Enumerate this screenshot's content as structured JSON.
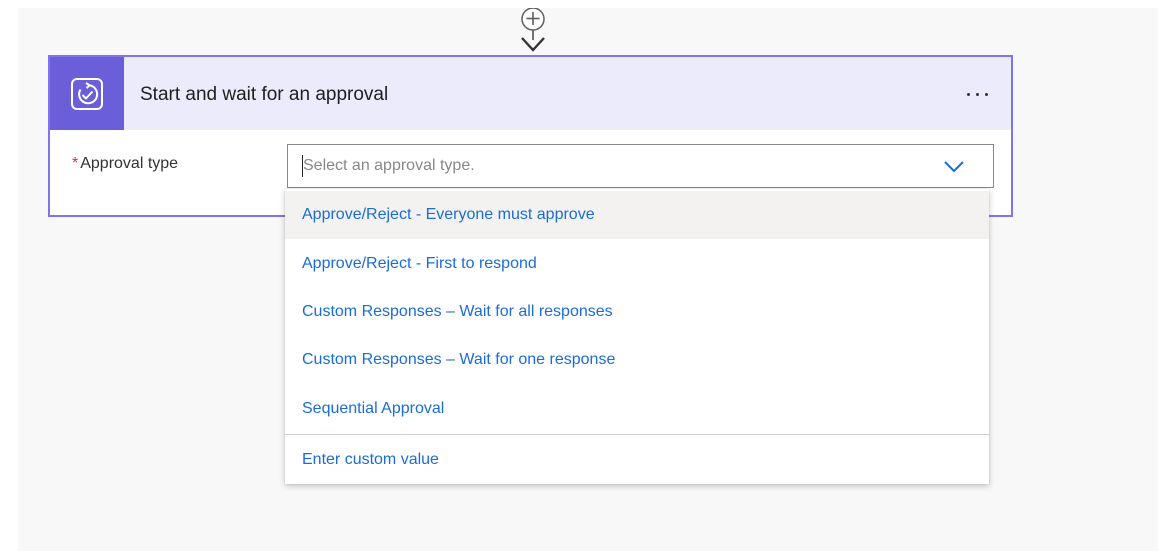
{
  "card": {
    "title": "Start and wait for an approval",
    "icon": "approval-icon",
    "accent_color": "#6a5fd8",
    "header_color": "#ebebfc",
    "more_icon": "ellipsis-icon"
  },
  "field": {
    "required_mark": "*",
    "label": "Approval type",
    "placeholder": "Select an approval type.",
    "value": ""
  },
  "dropdown": {
    "options": [
      "Approve/Reject - Everyone must approve",
      "Approve/Reject - First to respond",
      "Custom Responses – Wait for all responses",
      "Custom Responses – Wait for one response",
      "Sequential Approval"
    ],
    "custom_value": "Enter custom value",
    "option_color": "#1a6cd9"
  },
  "connector": {
    "icon": "add-step-icon"
  }
}
